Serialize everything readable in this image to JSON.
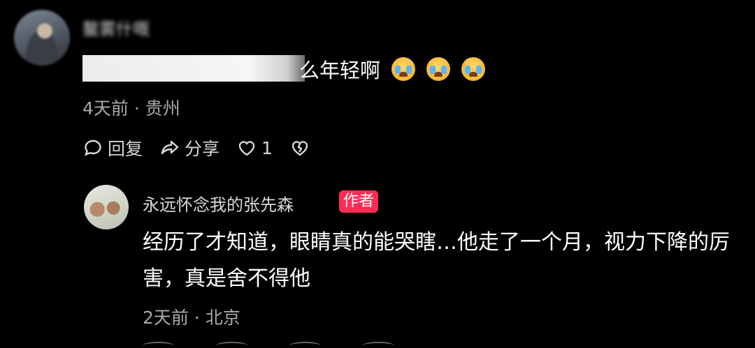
{
  "comment1": {
    "username": "鳌雾什嘅",
    "text_visible": "么年轻啊",
    "emojis": [
      "crying-emoji",
      "crying-emoji",
      "crying-emoji"
    ],
    "time": "4天前",
    "location": "贵州",
    "actions": {
      "reply_label": "回复",
      "share_label": "分享",
      "like_count": "1"
    }
  },
  "reply": {
    "username": "永远怀念我的张先森",
    "author_badge": "作者",
    "text": "经历了才知道，眼睛真的能哭瞎…他走了一个月，视力下降的厉害，真是舍不得他",
    "time": "2天前",
    "location": "北京"
  },
  "colors": {
    "background": "#000000",
    "badge": "#fe2c55",
    "meta_text": "#a9a9a9"
  }
}
